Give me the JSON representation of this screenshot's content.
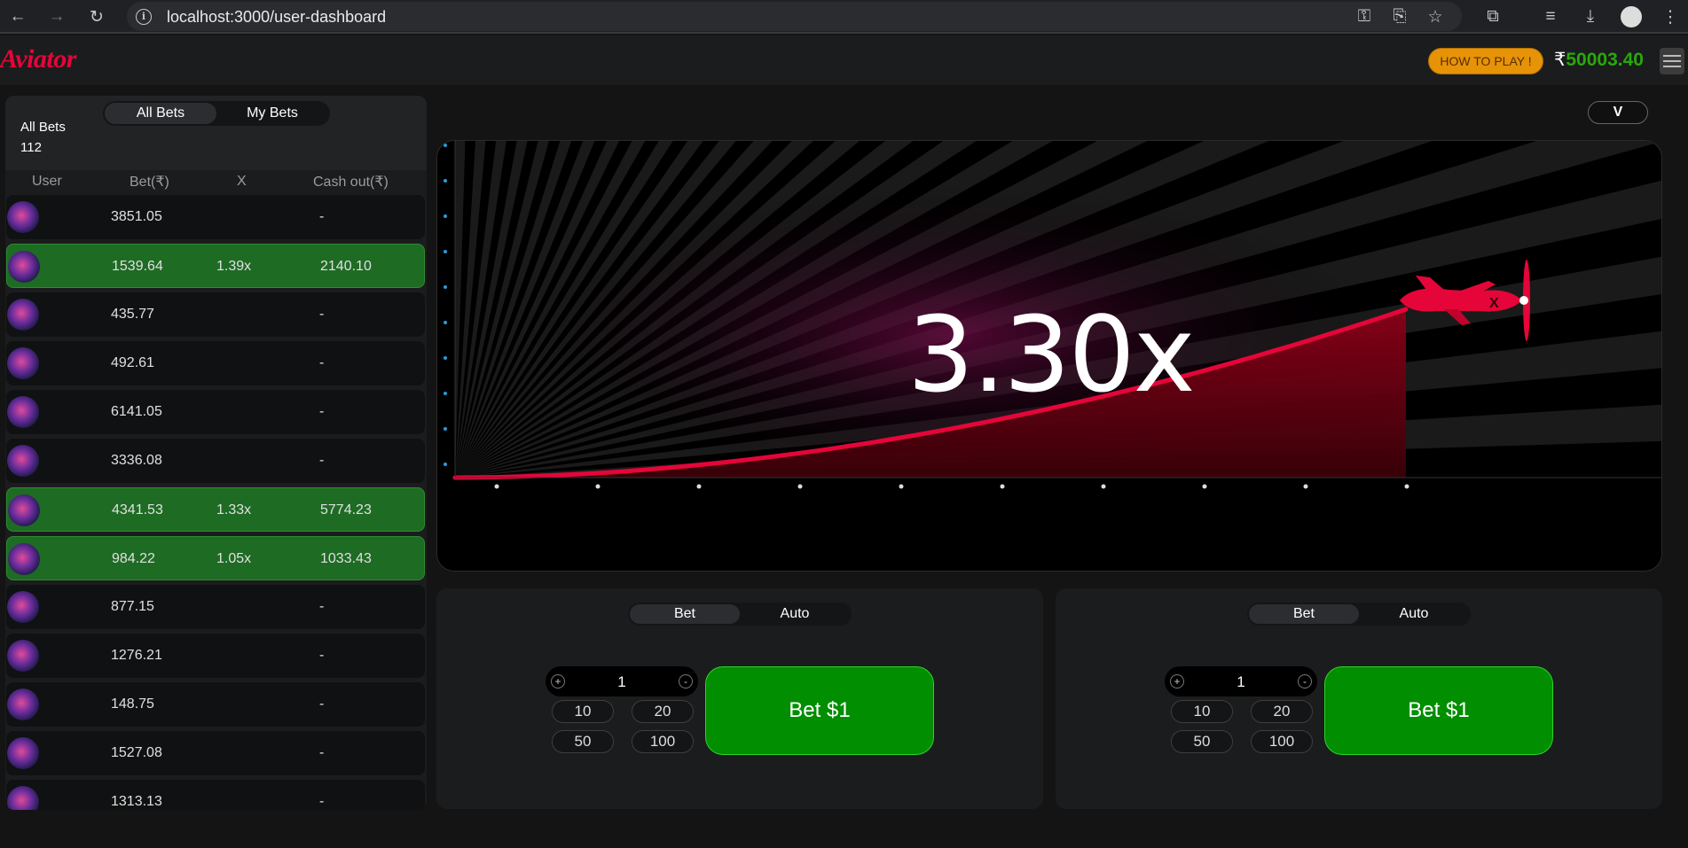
{
  "browser": {
    "url": "localhost:3000/user-dashboard"
  },
  "header": {
    "logo": "Aviator",
    "how_to_play": "HOW TO PLAY !",
    "currency": "₹",
    "balance": "50003.40"
  },
  "bets_panel": {
    "tabs": [
      "All Bets",
      "My Bets"
    ],
    "active_tab": "All Bets",
    "all_bets_label": "All Bets",
    "all_bets_count": "112",
    "columns": [
      "User",
      "Bet(₹)",
      "X",
      "Cash out(₹)"
    ],
    "rows": [
      {
        "bet": "3851.05",
        "x": "",
        "cashout": "-",
        "won": false
      },
      {
        "bet": "1539.64",
        "x": "1.39x",
        "cashout": "2140.10",
        "won": true
      },
      {
        "bet": "435.77",
        "x": "",
        "cashout": "-",
        "won": false
      },
      {
        "bet": "492.61",
        "x": "",
        "cashout": "-",
        "won": false
      },
      {
        "bet": "6141.05",
        "x": "",
        "cashout": "-",
        "won": false
      },
      {
        "bet": "3336.08",
        "x": "",
        "cashout": "-",
        "won": false
      },
      {
        "bet": "4341.53",
        "x": "1.33x",
        "cashout": "5774.23",
        "won": true
      },
      {
        "bet": "984.22",
        "x": "1.05x",
        "cashout": "1033.43",
        "won": true
      },
      {
        "bet": "877.15",
        "x": "",
        "cashout": "-",
        "won": false
      },
      {
        "bet": "1276.21",
        "x": "",
        "cashout": "-",
        "won": false
      },
      {
        "bet": "148.75",
        "x": "",
        "cashout": "-",
        "won": false
      },
      {
        "bet": "1527.08",
        "x": "",
        "cashout": "-",
        "won": false
      },
      {
        "bet": "1313.13",
        "x": "",
        "cashout": "-",
        "won": false
      }
    ]
  },
  "game": {
    "collapse_label": "V",
    "multiplier": "3.30x",
    "accent": "#e50539"
  },
  "bet_panels": [
    {
      "tabs": [
        "Bet",
        "Auto"
      ],
      "active_tab": "Bet",
      "amount": "1",
      "plus": "+",
      "minus": "-",
      "chips": [
        "10",
        "20",
        "50",
        "100"
      ],
      "bet_button": "Bet $1"
    },
    {
      "tabs": [
        "Bet",
        "Auto"
      ],
      "active_tab": "Bet",
      "amount": "1",
      "plus": "+",
      "minus": "-",
      "chips": [
        "10",
        "20",
        "50",
        "100"
      ],
      "bet_button": "Bet $1"
    }
  ]
}
